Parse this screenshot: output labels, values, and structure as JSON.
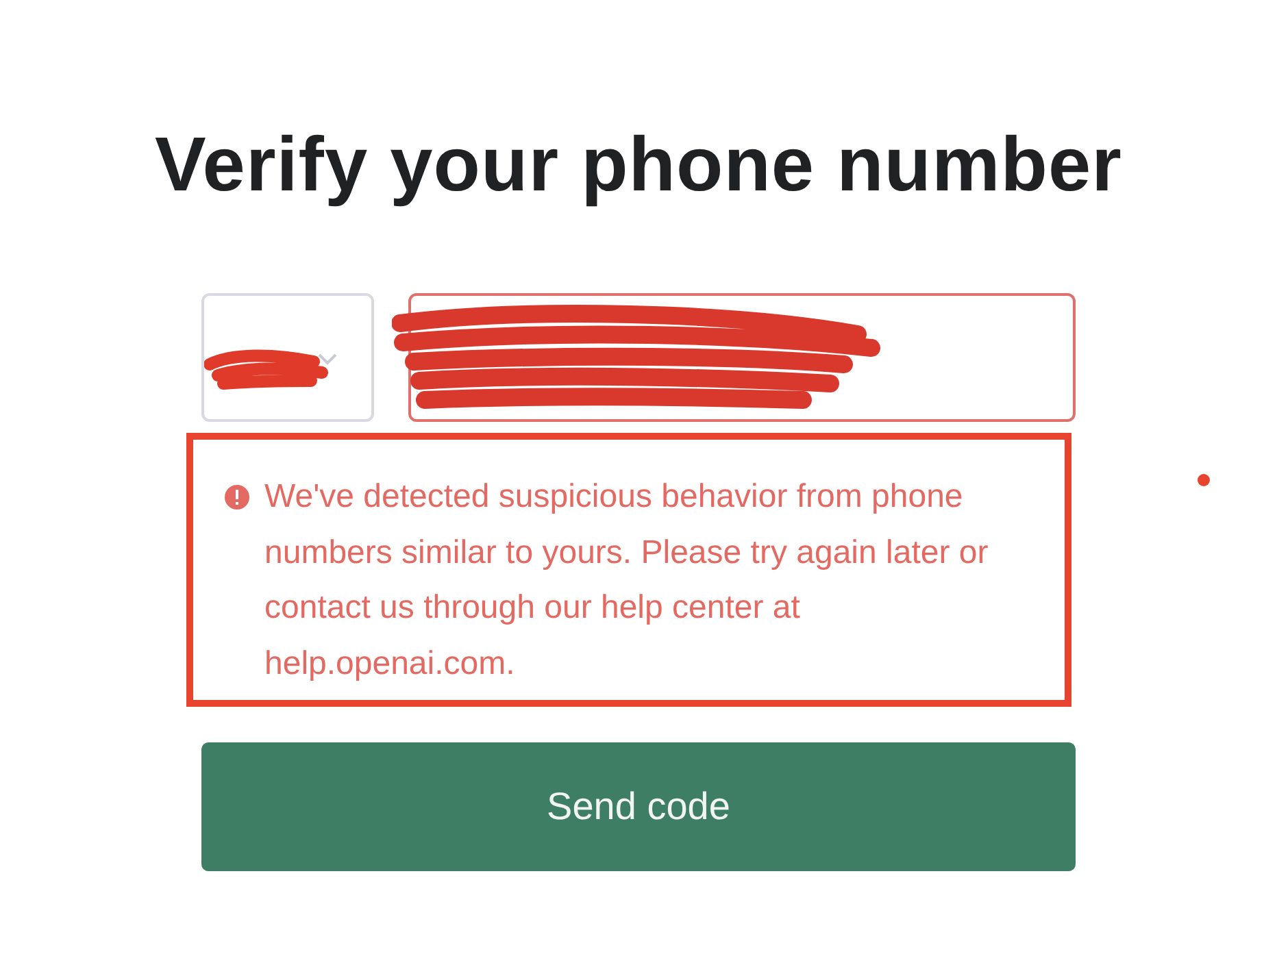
{
  "title": "Verify your phone number",
  "phone_field": {
    "invalid": true
  },
  "error": {
    "message": "We've detected suspicious behavior from phone numbers similar to yours. Please try again later or contact us through our help center at help.openai.com."
  },
  "submit_button": {
    "label": "Send code"
  }
}
